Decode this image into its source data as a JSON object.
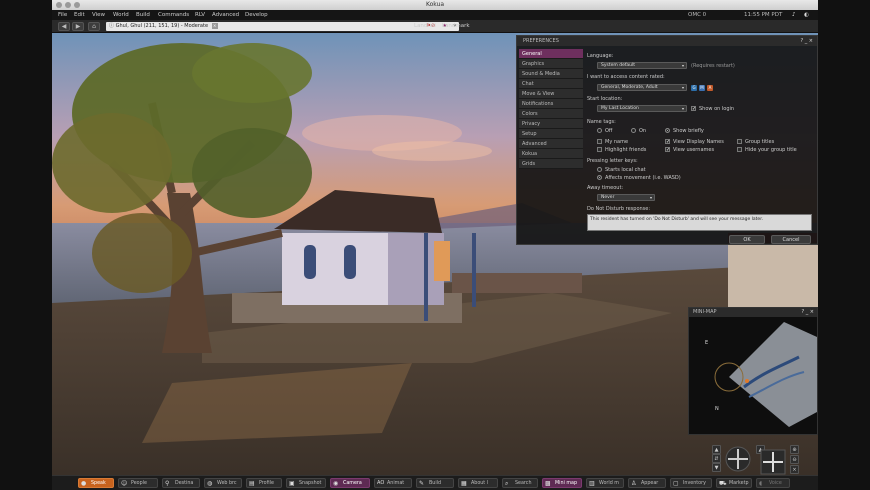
{
  "window": {
    "title": "Kokua"
  },
  "menubar": {
    "items": [
      "File",
      "Edit",
      "View",
      "World",
      "Build",
      "Commands",
      "RLV",
      "Advanced",
      "Develop"
    ],
    "balance": "OMC 0",
    "clock": "11:55 PM PDT"
  },
  "navbar": {
    "location": "Ghul, Ghul (211, 151, 19) - Moderate",
    "favorites": [
      "Landfall",
      "Landmark"
    ]
  },
  "prefs": {
    "title": "PREFERENCES",
    "controls": "? _ ×",
    "tabs": [
      "General",
      "Graphics",
      "Sound & Media",
      "Chat",
      "Move & View",
      "Notifications",
      "Colors",
      "Privacy",
      "Setup",
      "Advanced",
      "Kokua",
      "Grids"
    ],
    "language_label": "Language:",
    "language_value": "System default",
    "language_note": "(Requires restart)",
    "content_label": "I want to access content rated:",
    "content_value": "General, Moderate, Adult",
    "maturity_letters": [
      "G",
      "M",
      "A"
    ],
    "start_label": "Start location:",
    "start_value": "My Last Location",
    "show_on_login": "Show on login",
    "nametags_label": "Name tags:",
    "nametag_options": [
      "Off",
      "On",
      "Show briefly"
    ],
    "nametag_checks": [
      "My name",
      "View Display Names",
      "Group titles",
      "Highlight friends",
      "View usernames",
      "Hide your group title"
    ],
    "letter_keys_label": "Pressing letter keys:",
    "letter_keys_options": [
      "Starts local chat",
      "Affects movement (i.e. WASD)"
    ],
    "away_label": "Away timeout:",
    "away_value": "Never",
    "dnd_label": "Do Not Disturb response:",
    "dnd_text": "This resident has turned on 'Do Not Disturb' and will see your message later.",
    "ok": "OK",
    "cancel": "Cancel"
  },
  "minimap": {
    "title": "MINI-MAP",
    "controls": "? _ ×",
    "n_label": "N",
    "e_label": "E"
  },
  "bottombar": {
    "buttons": [
      "Speak",
      "People",
      "Destina",
      "Web brc",
      "Profile",
      "Snapshot",
      "Camera",
      "Animat",
      "Build",
      "About l",
      "Search",
      "Mini map",
      "World m",
      "Appear",
      "Inventory",
      "Marketp",
      "Voice"
    ]
  },
  "colors": {
    "accent": "#6e2f5e",
    "speak": "#c8631e"
  }
}
